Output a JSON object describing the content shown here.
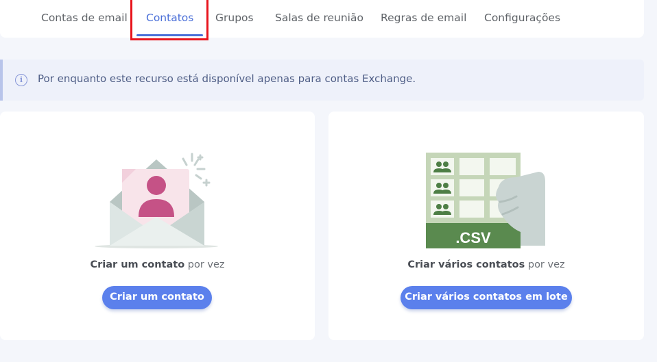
{
  "tabs": [
    {
      "label": "Contas de email",
      "active": false
    },
    {
      "label": "Contatos",
      "active": true
    },
    {
      "label": "Grupos",
      "active": false
    },
    {
      "label": "Salas de reunião",
      "active": false
    },
    {
      "label": "Regras de email",
      "active": false
    },
    {
      "label": "Configurações",
      "active": false
    }
  ],
  "notice": {
    "text": "Por enquanto este recurso está disponível apenas para contas Exchange.",
    "icon": "info-icon"
  },
  "single_card": {
    "caption_bold": "Criar um contato",
    "caption_rest": " por vez",
    "button_label": "Criar um contato",
    "icon": "envelope-contact-icon"
  },
  "bulk_card": {
    "caption_bold": "Criar vários contatos",
    "caption_rest": " por vez",
    "button_label": "Criar vários contatos em lote",
    "csv_label": ".CSV",
    "icon": "csv-spreadsheet-icon"
  },
  "colors": {
    "accent": "#4a6fd8",
    "button": "#5b80ec",
    "highlight": "#e8141c",
    "csv_green": "#5a8a4f"
  }
}
